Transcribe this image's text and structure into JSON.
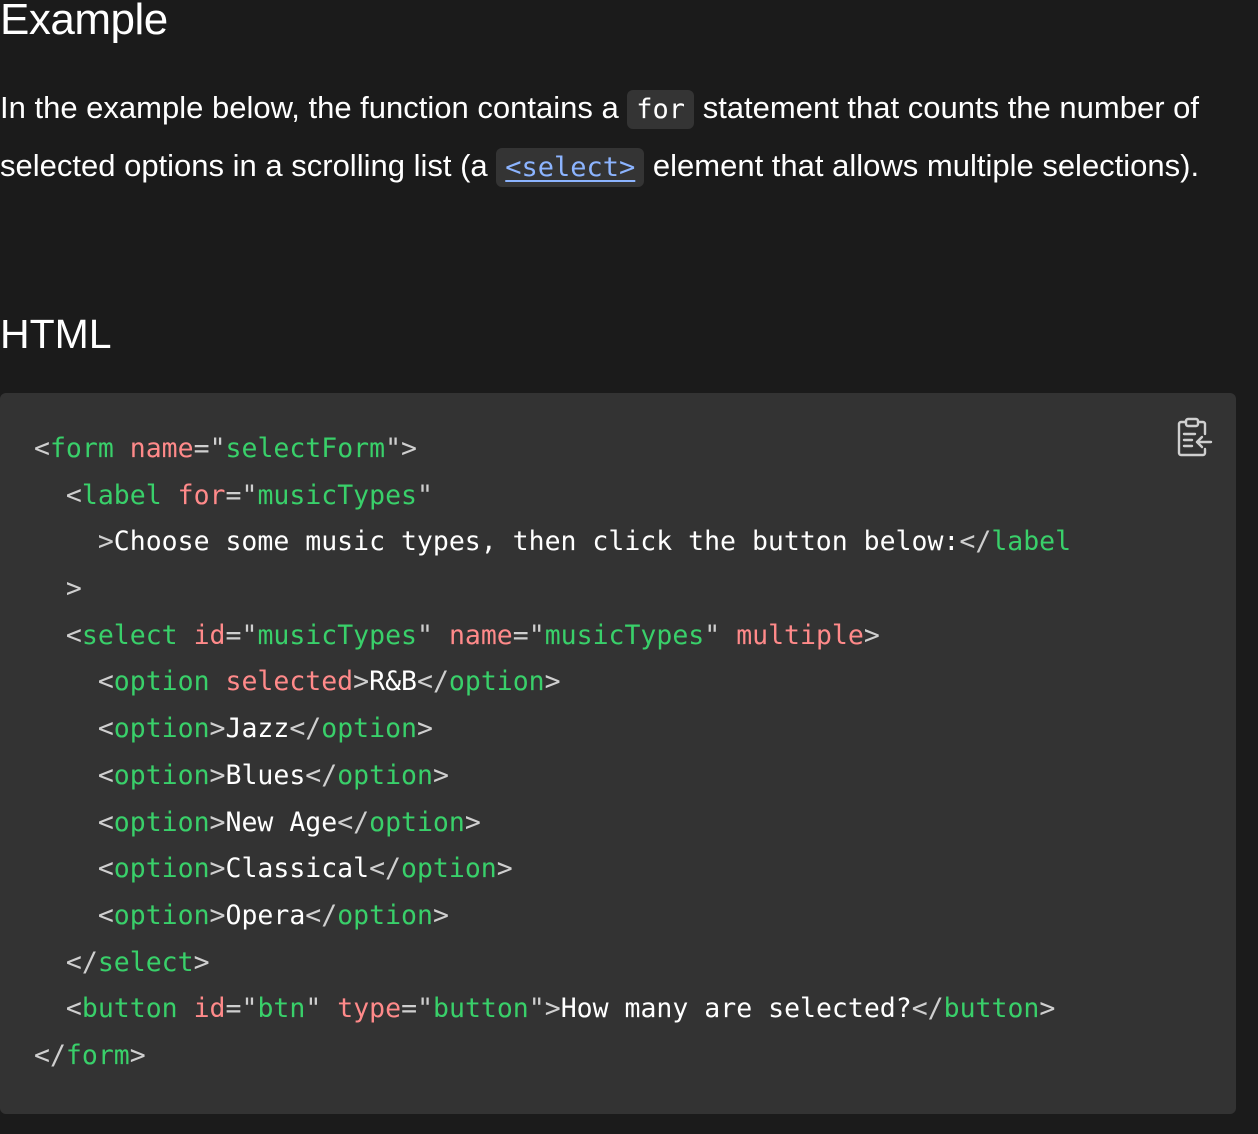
{
  "section": {
    "heading": "Example",
    "paragraph": {
      "part1": "In the example below, the function contains a ",
      "code_for": "for",
      "part2": " statement that counts the number of selected options in a scrolling list (a ",
      "link_select": "<select>",
      "part3": " element that allows multiple selections)."
    },
    "subheading": "HTML"
  },
  "code_block": {
    "copy_icon": "clipboard-icon",
    "lines": {
      "l1": {
        "lt": "<",
        "tag": "form",
        "sp": " ",
        "attr": "name",
        "eq": "=",
        "q1": "\"",
        "val": "selectForm",
        "q2": "\"",
        "gt": ">"
      },
      "l2": {
        "indent": "  ",
        "lt": "<",
        "tag": "label",
        "sp": " ",
        "attr": "for",
        "eq": "=",
        "q1": "\"",
        "val": "musicTypes",
        "q2": "\""
      },
      "l3": {
        "indent": "    ",
        "gt": ">",
        "text": "Choose some music types, then click the button below:",
        "lt_close": "</",
        "tag": "label"
      },
      "l4": {
        "indent": "  ",
        "gt": ">"
      },
      "l5": {
        "indent": "  ",
        "lt": "<",
        "tag": "select",
        "sp1": " ",
        "attr1": "id",
        "eq1": "=",
        "q1a": "\"",
        "val1": "musicTypes",
        "q1b": "\"",
        "sp2": " ",
        "attr2": "name",
        "eq2": "=",
        "q2a": "\"",
        "val2": "musicTypes",
        "q2b": "\"",
        "sp3": " ",
        "attr3": "multiple",
        "gt": ">"
      },
      "l6": {
        "indent": "    ",
        "lt": "<",
        "tag": "option",
        "sp": " ",
        "attr": "selected",
        "gt": ">",
        "text": "R&B",
        "lt_close": "</",
        "tag_close": "option",
        "gt_close": ">"
      },
      "l7": {
        "indent": "    ",
        "lt": "<",
        "tag": "option",
        "gt": ">",
        "text": "Jazz",
        "lt_close": "</",
        "tag_close": "option",
        "gt_close": ">"
      },
      "l8": {
        "indent": "    ",
        "lt": "<",
        "tag": "option",
        "gt": ">",
        "text": "Blues",
        "lt_close": "</",
        "tag_close": "option",
        "gt_close": ">"
      },
      "l9": {
        "indent": "    ",
        "lt": "<",
        "tag": "option",
        "gt": ">",
        "text": "New Age",
        "lt_close": "</",
        "tag_close": "option",
        "gt_close": ">"
      },
      "l10": {
        "indent": "    ",
        "lt": "<",
        "tag": "option",
        "gt": ">",
        "text": "Classical",
        "lt_close": "</",
        "tag_close": "option",
        "gt_close": ">"
      },
      "l11": {
        "indent": "    ",
        "lt": "<",
        "tag": "option",
        "gt": ">",
        "text": "Opera",
        "lt_close": "</",
        "tag_close": "option",
        "gt_close": ">"
      },
      "l12": {
        "indent": "  ",
        "lt": "</",
        "tag": "select",
        "gt": ">"
      },
      "l13": {
        "indent": "  ",
        "lt": "<",
        "tag": "button",
        "sp1": " ",
        "attr1": "id",
        "eq1": "=",
        "q1a": "\"",
        "val1": "btn",
        "q1b": "\"",
        "sp2": " ",
        "attr2": "type",
        "eq2": "=",
        "q2a": "\"",
        "val2": "button",
        "q2b": "\"",
        "gt": ">",
        "text": "How many are selected?",
        "lt_close": "</",
        "tag_close": "button",
        "gt_close": ">"
      },
      "l14": {
        "lt": "</",
        "tag": "form",
        "gt": ">"
      }
    }
  },
  "colors": {
    "background": "#1b1b1b",
    "code_background": "#333333",
    "tag": "#39d06a",
    "attribute": "#ff8a8a",
    "link": "#8cb4ff"
  }
}
